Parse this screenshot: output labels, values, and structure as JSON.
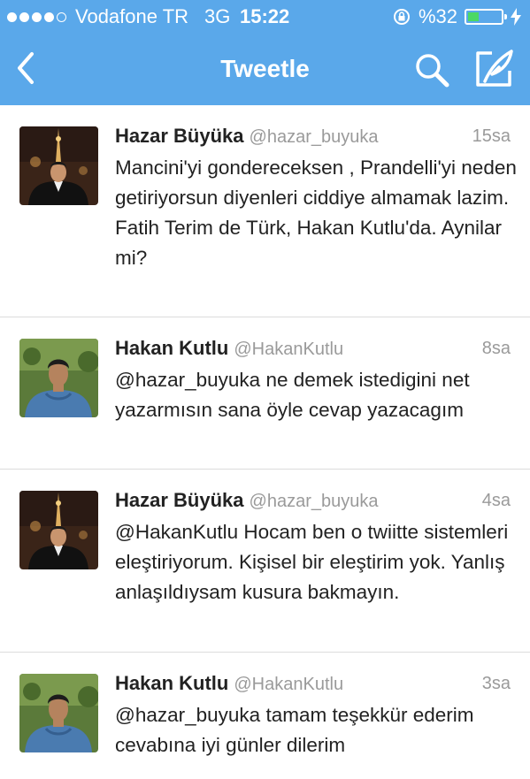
{
  "status_bar": {
    "carrier": "Vodafone TR",
    "network": "3G",
    "time": "15:22",
    "battery": "%32",
    "battery_level": 0.32,
    "signal_bars_filled": 4,
    "signal_bars_total": 5
  },
  "nav": {
    "title": "Tweetle",
    "back_icon": "chevron-left-icon",
    "search_icon": "search-icon",
    "compose_icon": "compose-icon"
  },
  "colors": {
    "header_bg": "#5aa8ea",
    "battery_fill": "#4cd964",
    "name_text": "#222222",
    "meta_text": "#9a9a9a"
  },
  "tweets": [
    {
      "name": "Hazar Büyüka",
      "handle": "@hazar_buyuka",
      "time": "15sa",
      "text": "Mancini'yi gondereceksen , Prandelli'yi neden getiriyorsun diyenleri ciddiye almamak lazim. Fatih Terim de Türk, Hakan Kutlu'da. Aynilar mi?"
    },
    {
      "name": "Hakan Kutlu",
      "handle": "@HakanKutlu",
      "time": "8sa",
      "text": "@hazar_buyuka ne demek istedigini net yazarmısın sana öyle cevap yazacagım"
    },
    {
      "name": "Hazar Büyüka",
      "handle": "@hazar_buyuka",
      "time": "4sa",
      "text": "@HakanKutlu Hocam ben o twiitte sistemleri eleştiriyorum. Kişisel bir eleştirim yok. Yanlış anlaşıldıysam kusura bakmayın."
    },
    {
      "name": "Hakan Kutlu",
      "handle": "@HakanKutlu",
      "time": "3sa",
      "text": "@hazar_buyuka tamam teşekkür ederim cevabına iyi günler dilerim"
    }
  ]
}
